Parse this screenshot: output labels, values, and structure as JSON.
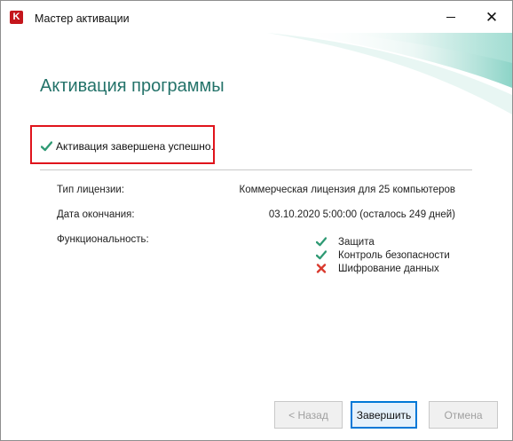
{
  "window": {
    "title": "Мастер активации",
    "app_icon_letter": "K",
    "app_icon_color": "#c4161c"
  },
  "page": {
    "heading": "Активация программы",
    "heading_color": "#24736a"
  },
  "status": {
    "text": "Активация завершена успешно.",
    "icon": "check-icon",
    "highlight_color": "#e0141c"
  },
  "license": {
    "type_label": "Тип лицензии:",
    "type_value": "Коммерческая лицензия для 25 компьютеров",
    "expiry_label": "Дата окончания:",
    "expiry_value": "03.10.2020 5:00:00 (осталось 249 дней)",
    "features_label": "Функциональность:",
    "features": [
      {
        "label": "Защита",
        "enabled": true,
        "icon": "check-icon"
      },
      {
        "label": "Контроль безопасности",
        "enabled": true,
        "icon": "check-icon"
      },
      {
        "label": "Шифрование данных",
        "enabled": false,
        "icon": "cross-icon"
      }
    ]
  },
  "buttons": {
    "back": "< Назад",
    "finish": "Завершить",
    "cancel": "Отмена"
  },
  "colors": {
    "check": "#2f9a74",
    "cross": "#d9382c",
    "accent_teal": "#24736a",
    "focus_blue": "#0078d7"
  }
}
